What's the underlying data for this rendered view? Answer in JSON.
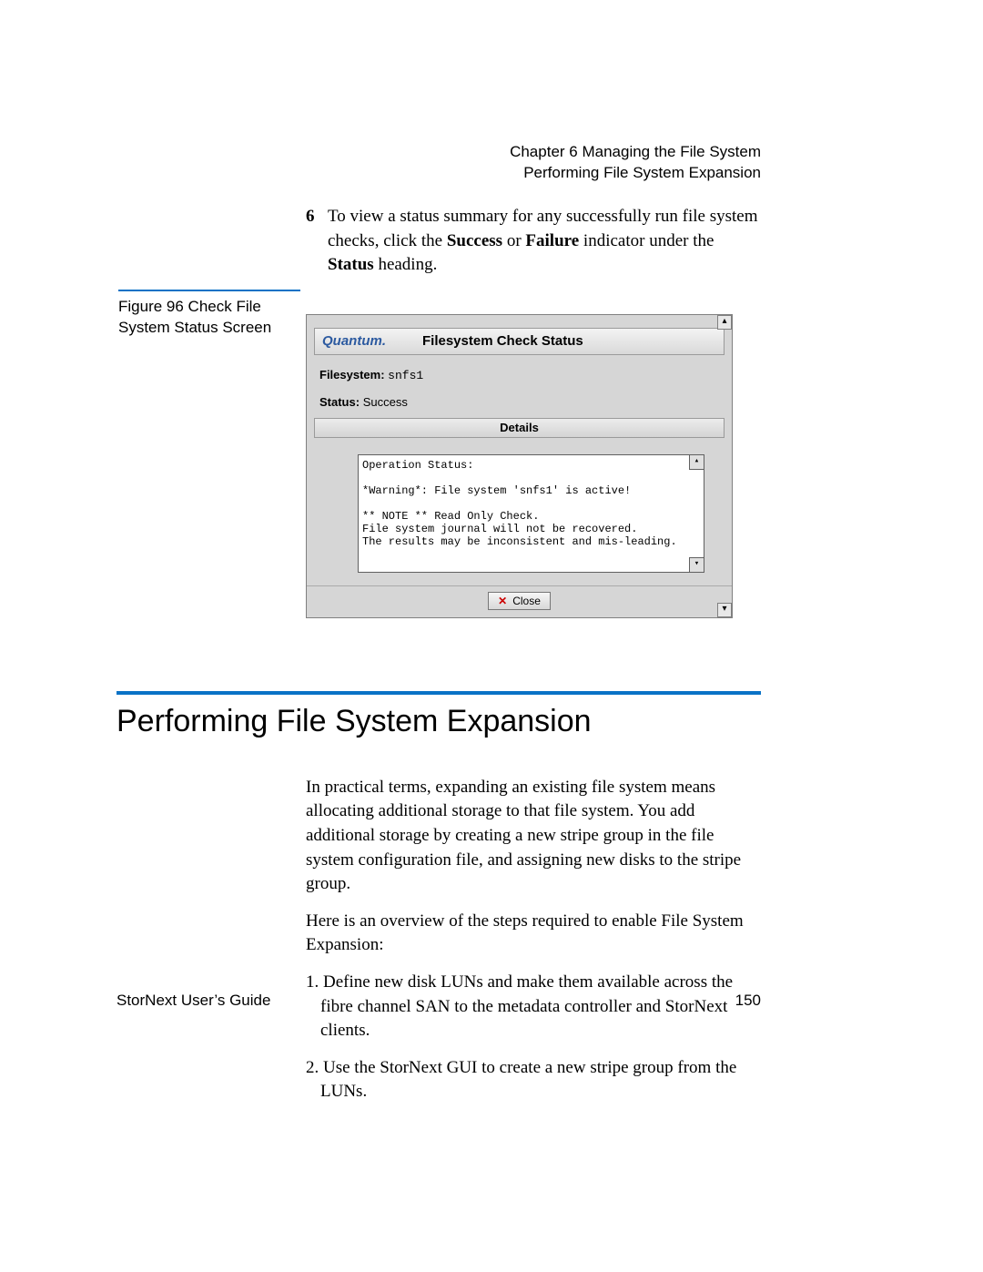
{
  "header": {
    "chapter": "Chapter 6  Managing the File System",
    "section": "Performing File System Expansion"
  },
  "step6": {
    "number": "6",
    "text_pre": "To view a status summary for any successfully run file system checks, click the ",
    "bold1": "Success",
    "mid1": " or ",
    "bold2": "Failure",
    "mid2": " indicator under the ",
    "bold3": "Status",
    "tail": " heading."
  },
  "figure": {
    "label": "Figure 96  Check File System Status Screen"
  },
  "dialog": {
    "brand": "Quantum.",
    "title": "Filesystem Check Status",
    "fs_label": "Filesystem:",
    "fs_value": "snfs1",
    "status_label": "Status:",
    "status_value": "Success",
    "details_header": "Details",
    "details_text": "Operation Status:\n\n*Warning*: File system 'snfs1' is active!\n\n** NOTE ** Read Only Check.\nFile system journal will not be recovered.\nThe results may be inconsistent and mis-leading.",
    "close_label": "Close"
  },
  "section_heading": "Performing File System Expansion",
  "body": {
    "p1": "In practical terms, expanding an existing file system means allocating additional storage to that file system. You add additional storage by creating a new stripe group in the file system configuration file, and assigning new disks to the stripe group.",
    "p2": "Here is an overview of the steps required to enable File System Expansion:",
    "li1": "1. Define new disk LUNs and make them available across the fibre channel SAN to the metadata controller and StorNext clients.",
    "li2": "2. Use the StorNext GUI to create a new stripe group from the LUNs."
  },
  "footer": {
    "left": "StorNext User’s Guide",
    "right": "150"
  }
}
